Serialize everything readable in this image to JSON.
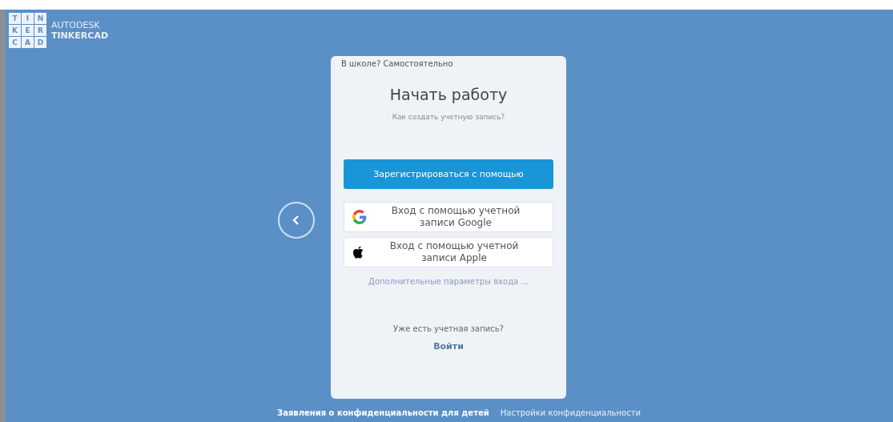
{
  "logo": {
    "tiles": [
      "T",
      "I",
      "N",
      "K",
      "E",
      "R",
      "C",
      "A",
      "D"
    ],
    "brand_line_1": "AUTODESK",
    "brand_line_2": "TINKERCAD"
  },
  "card": {
    "top_link": "В школе? Самостоятельно",
    "title": "Начать работу",
    "subtitle": "Как создать учетную запись?",
    "primary_button": "Зарегистрироваться с помощью",
    "providers": [
      {
        "kind": "google",
        "label": "Вход с помощью учетной записи Google"
      },
      {
        "kind": "apple",
        "label": "Вход с помощью учетной записи Apple"
      }
    ],
    "more_options": "Дополнительные параметры входа ...",
    "have_account": "Уже есть учетная запись?",
    "sign_in": "Войти"
  },
  "footer": [
    {
      "label": "Заявления о конфиденциальности для детей",
      "bold": true
    },
    {
      "label": "Настройки конфиденциальности",
      "bold": false
    }
  ]
}
